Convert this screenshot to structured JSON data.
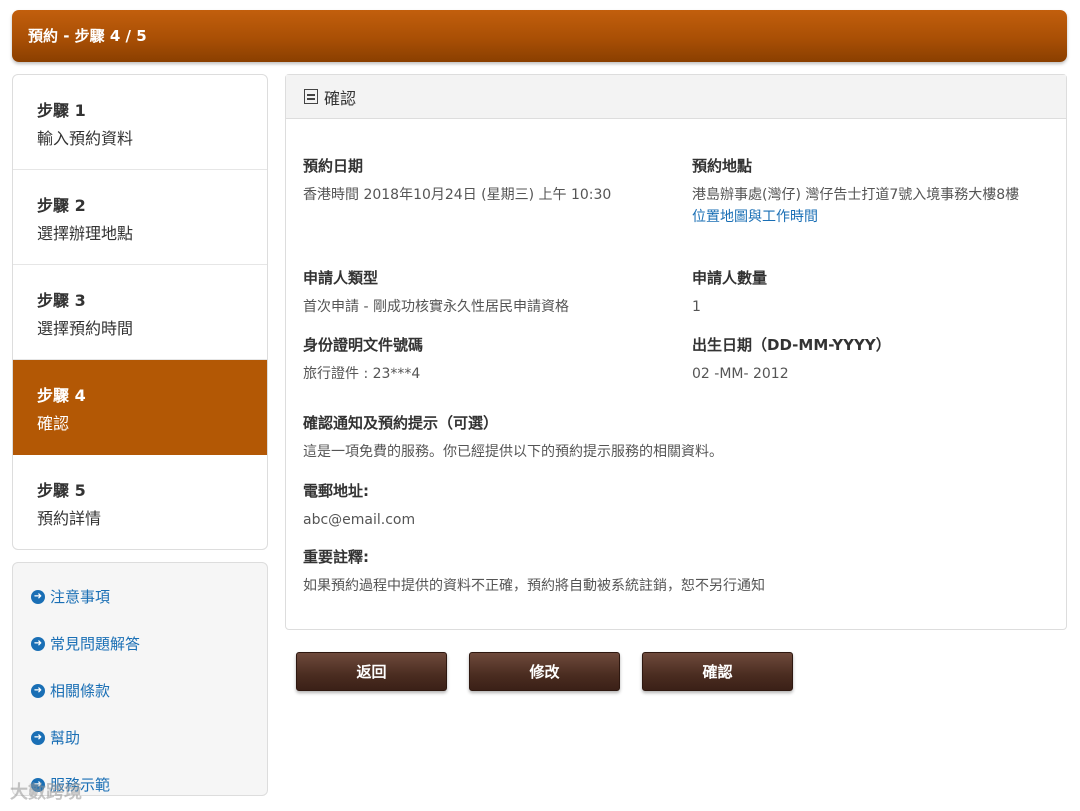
{
  "header": {
    "title": "預約 - 步驟 4 / 5"
  },
  "steps": [
    {
      "num": "步驟 1",
      "label": "輸入預約資料"
    },
    {
      "num": "步驟 2",
      "label": "選擇辦理地點"
    },
    {
      "num": "步驟 3",
      "label": "選擇預約時間"
    },
    {
      "num": "步驟 4",
      "label": "確認"
    },
    {
      "num": "步驟 5",
      "label": "預約詳情"
    }
  ],
  "links": [
    "注意事項",
    "常見問題解答",
    "相關條款",
    "幫助",
    "服務示範"
  ],
  "panel": {
    "title": "確認",
    "date_label": "預約日期",
    "date_value": "香港時間 2018年10月24日 (星期三) 上午 10:30",
    "location_label": "預約地點",
    "location_value": "港島辦事處(灣仔) 灣仔告士打道7號入境事務大樓8樓",
    "location_link": "位置地圖與工作時間",
    "applicant_type_label": "申請人類型",
    "applicant_type_value": "首次申請 - 剛成功核實永久性居民申請資格",
    "applicant_count_label": "申請人數量",
    "applicant_count_value": "1",
    "id_label": "身份證明文件號碼",
    "id_value": "旅行證件 : 23***4",
    "dob_label": "出生日期（DD-MM-YYYY）",
    "dob_value": "02 -MM- 2012",
    "notify_label": "確認通知及預約提示（可選）",
    "notify_value": "這是一項免費的服務。你已經提供以下的預約提示服務的相關資料。",
    "email_label": "電郵地址:",
    "email_value": "abc@email.com",
    "note_label": "重要註釋:",
    "note_value": "如果預約過程中提供的資料不正確，預約將自動被系統註銷，恕不另行通知"
  },
  "buttons": {
    "back": "返回",
    "edit": "修改",
    "confirm": "確認"
  },
  "watermark": "大數跨境",
  "colors": {
    "accent": "#b35805",
    "link": "#1a6fb5",
    "button": "#4a2c20"
  }
}
